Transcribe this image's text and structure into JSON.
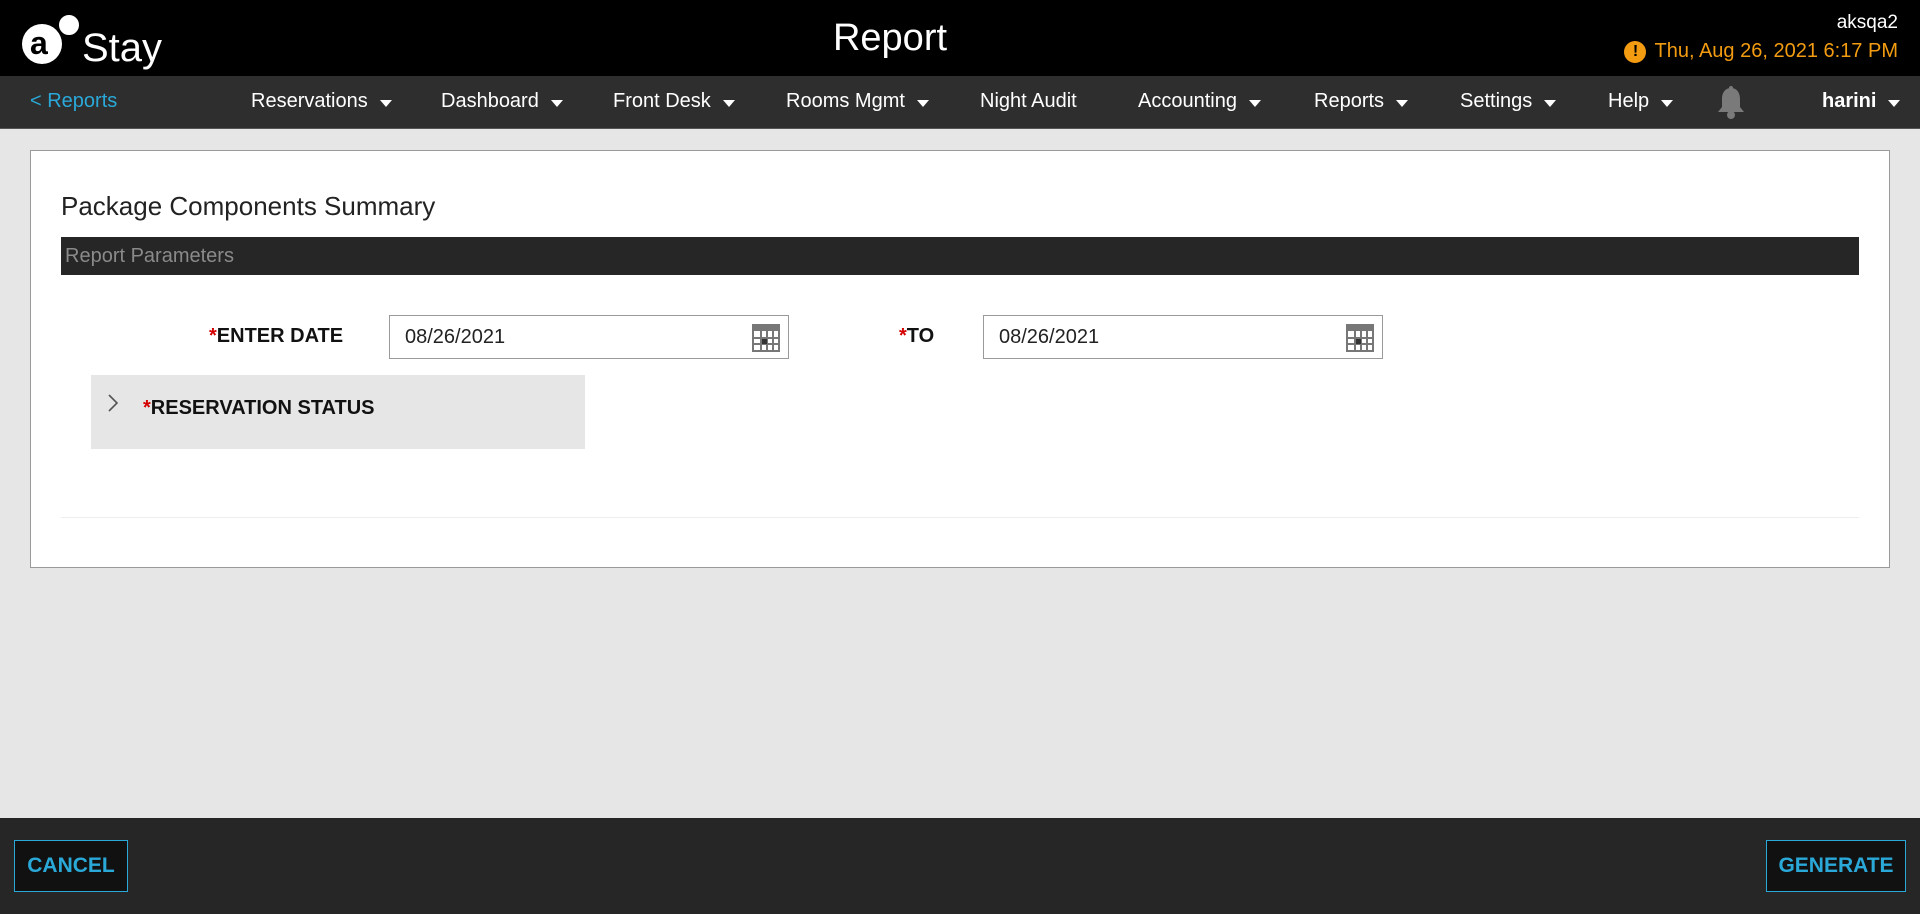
{
  "header": {
    "brand": "Stay",
    "title": "Report",
    "user_code": "aksqa2",
    "datetime": "Thu, Aug 26, 2021 6:17 PM",
    "accent_color": "#f39c12"
  },
  "nav": {
    "back_label": "< Reports",
    "items": [
      {
        "label": "Reservations",
        "dropdown": true
      },
      {
        "label": "Dashboard",
        "dropdown": true
      },
      {
        "label": "Front Desk",
        "dropdown": true
      },
      {
        "label": "Rooms Mgmt",
        "dropdown": true
      },
      {
        "label": "Night Audit",
        "dropdown": false
      },
      {
        "label": "Accounting",
        "dropdown": true
      },
      {
        "label": "Reports",
        "dropdown": true
      },
      {
        "label": "Settings",
        "dropdown": true
      },
      {
        "label": "Help",
        "dropdown": true
      }
    ],
    "bell_icon": "bell-icon",
    "user": "harini"
  },
  "report": {
    "title": "Package Components Summary",
    "params_header": "Report Parameters",
    "required_mark": "*",
    "from_label": "ENTER DATE",
    "from_value": "08/26/2021",
    "to_label": "TO",
    "to_value": "08/26/2021",
    "status_label": "RESERVATION STATUS"
  },
  "footer": {
    "cancel_label": "CANCEL",
    "generate_label": "GENERATE",
    "button_color": "#2aa9d9"
  }
}
